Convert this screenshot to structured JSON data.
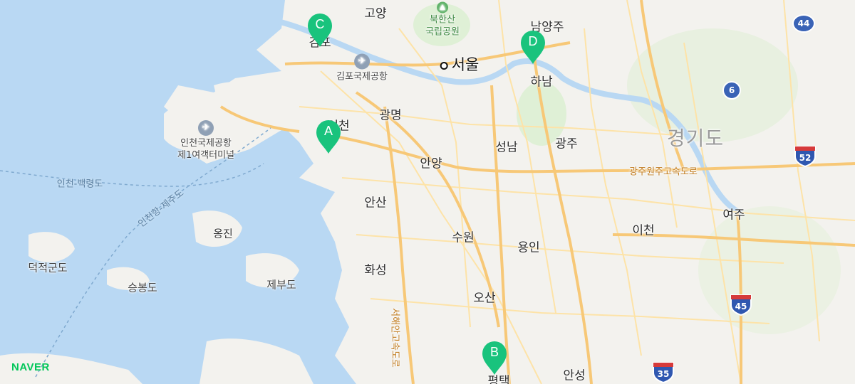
{
  "map": {
    "brand": "NAVER",
    "province_label": "경기도",
    "capital": "서울",
    "cities": [
      "고양",
      "하남",
      "광명",
      "성남",
      "광주",
      "안양",
      "안산",
      "수원",
      "용인",
      "이천",
      "여주",
      "화성",
      "오산",
      "안성",
      "평택",
      "남양주",
      "김포",
      "인천"
    ],
    "islands": [
      "옹진",
      "덕적군도",
      "승봉도",
      "제부도"
    ],
    "park": {
      "line1": "북한산",
      "line2": "국립공원"
    },
    "airports": [
      {
        "line1": "김포국제공항",
        "line2": ""
      },
      {
        "line1": "인천국제공항",
        "line2": "제1여객터미널"
      }
    ],
    "roads": {
      "expressway": "광주원주고속도로",
      "west_coast": "서해안고속도로"
    },
    "ferry_routes": [
      "인천-백령도",
      "인천항-제주도"
    ],
    "route_shields": [
      "44",
      "6",
      "52",
      "45",
      "35"
    ],
    "markers": [
      {
        "label": "A",
        "color": "#19c37d"
      },
      {
        "label": "B",
        "color": "#19c37d"
      },
      {
        "label": "C",
        "color": "#19c37d"
      },
      {
        "label": "D",
        "color": "#19c37d"
      }
    ],
    "colors": {
      "sea": "#b9d8f3",
      "land": "#f3f2ee",
      "road_major": "#f7c877",
      "road_minor": "#fde3a8",
      "river": "#b9d8f3",
      "park": "#dff0d6",
      "marker": "#19c37d",
      "brand": "#03c75a"
    }
  }
}
